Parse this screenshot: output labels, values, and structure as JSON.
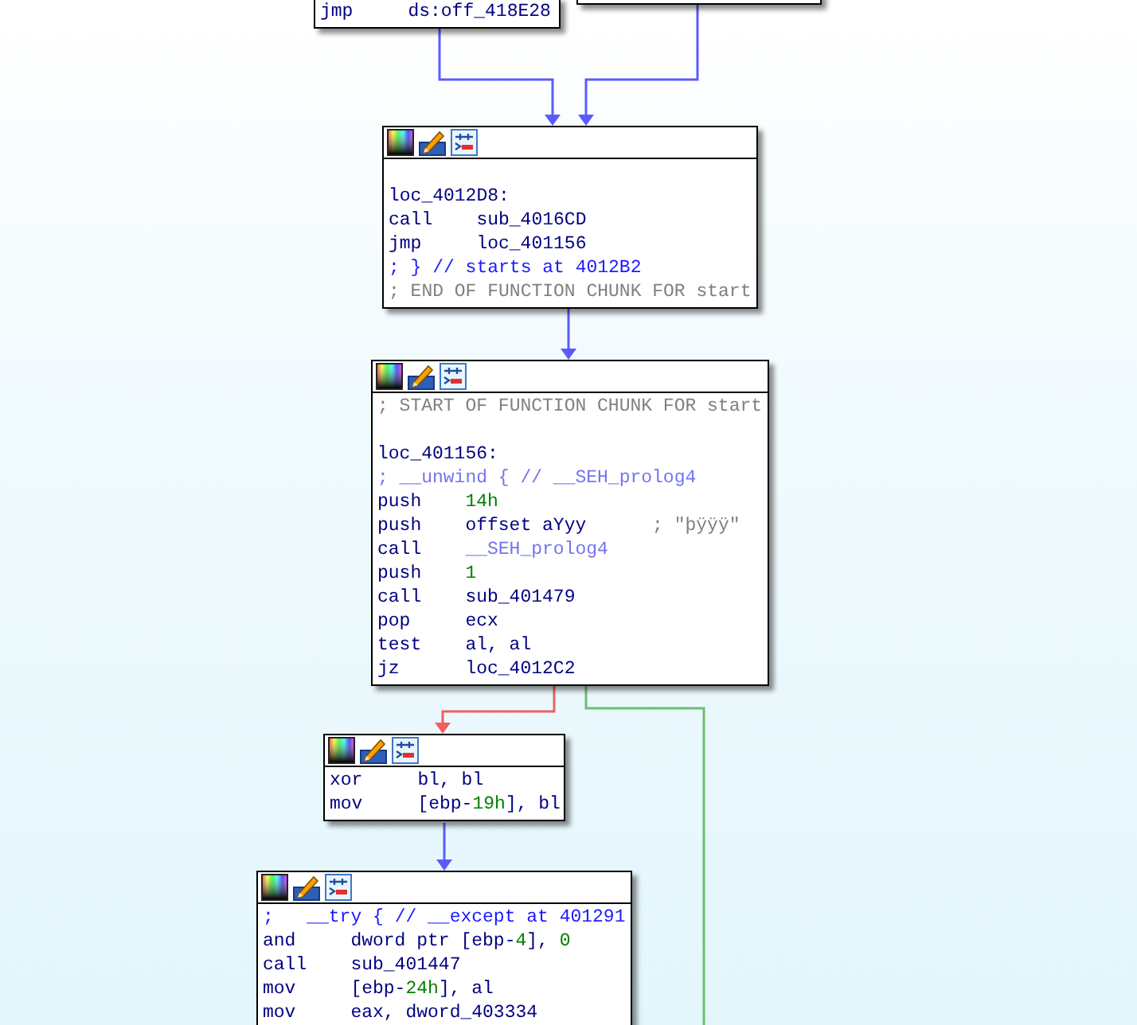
{
  "nodes": [
    {
      "toolbar": false,
      "lines": [
        {
          "kind": "instruction",
          "mnemonic": "jmp",
          "operands": [
            {
              "text": "ds:off_418E28",
              "kind": "plain"
            }
          ]
        }
      ]
    },
    {
      "toolbar": false
    },
    {
      "toolbar": true,
      "lines": [
        {
          "kind": "label",
          "text": "loc_4012D8:",
          "space_before": true
        },
        {
          "kind": "instruction",
          "mnemonic": "call",
          "operands": [
            {
              "text": "sub_4016CD",
              "kind": "plain"
            }
          ]
        },
        {
          "kind": "instruction",
          "mnemonic": "jmp",
          "operands": [
            {
              "text": "loc_401156",
              "kind": "plain"
            }
          ]
        },
        {
          "kind": "comment",
          "text": "; } // starts at 4012B2"
        },
        {
          "kind": "annotation",
          "text": "; END OF FUNCTION CHUNK FOR start"
        }
      ]
    },
    {
      "toolbar": true,
      "lines": [
        {
          "kind": "annotation",
          "text": "; START OF FUNCTION CHUNK FOR start"
        },
        {
          "kind": "label",
          "text": "loc_401156:",
          "space_before": true
        },
        {
          "kind": "hint",
          "text": "; __unwind { // __SEH_prolog4"
        },
        {
          "kind": "instruction",
          "mnemonic": "push",
          "operands": [
            {
              "text": "14h",
              "kind": "number"
            }
          ]
        },
        {
          "kind": "instruction",
          "mnemonic": "push",
          "operands": [
            {
              "text": "offset aYyy",
              "kind": "plain"
            }
          ],
          "comment": "; \"þÿÿÿ\""
        },
        {
          "kind": "instruction",
          "mnemonic": "call",
          "operands": [
            {
              "text": "__SEH_prolog4",
              "kind": "faint"
            }
          ]
        },
        {
          "kind": "instruction",
          "mnemonic": "push",
          "operands": [
            {
              "text": "1",
              "kind": "number"
            }
          ]
        },
        {
          "kind": "instruction",
          "mnemonic": "call",
          "operands": [
            {
              "text": "sub_401479",
              "kind": "plain"
            }
          ]
        },
        {
          "kind": "instruction",
          "mnemonic": "pop",
          "operands": [
            {
              "text": "ecx",
              "kind": "plain"
            }
          ]
        },
        {
          "kind": "instruction",
          "mnemonic": "test",
          "operands": [
            {
              "text": "al, al",
              "kind": "plain"
            }
          ]
        },
        {
          "kind": "instruction",
          "mnemonic": "jz",
          "operands": [
            {
              "text": "loc_4012C2",
              "kind": "plain"
            }
          ]
        }
      ]
    },
    {
      "toolbar": true,
      "lines": [
        {
          "kind": "instruction",
          "mnemonic": "xor",
          "operands": [
            {
              "text": "bl, bl",
              "kind": "plain"
            }
          ]
        },
        {
          "kind": "instruction",
          "mnemonic": "mov",
          "operands": [
            {
              "text": "[ebp-",
              "kind": "plain"
            },
            {
              "text": "19h",
              "kind": "number"
            },
            {
              "text": "], bl",
              "kind": "plain"
            }
          ]
        }
      ]
    },
    {
      "toolbar": true,
      "lines": [
        {
          "kind": "comment",
          "text": ";   __try { // __except at 401291"
        },
        {
          "kind": "instruction",
          "mnemonic": "and",
          "operands": [
            {
              "text": "dword ptr [ebp-",
              "kind": "plain"
            },
            {
              "text": "4",
              "kind": "number"
            },
            {
              "text": "], ",
              "kind": "plain"
            },
            {
              "text": "0",
              "kind": "number"
            }
          ]
        },
        {
          "kind": "instruction",
          "mnemonic": "call",
          "operands": [
            {
              "text": "sub_401447",
              "kind": "plain"
            }
          ]
        },
        {
          "kind": "instruction",
          "mnemonic": "mov",
          "operands": [
            {
              "text": "[ebp-",
              "kind": "plain"
            },
            {
              "text": "24h",
              "kind": "number"
            },
            {
              "text": "], al",
              "kind": "plain"
            }
          ]
        },
        {
          "kind": "instruction",
          "mnemonic": "mov",
          "operands": [
            {
              "text": "eax, dword_403334",
              "kind": "plain"
            }
          ]
        }
      ]
    }
  ],
  "edges": [
    {
      "color": "#5a5aff"
    },
    {
      "color": "#5a5aff"
    },
    {
      "color": "#5a5aff"
    },
    {
      "color": "#f06060"
    },
    {
      "color": "#6cbf6c"
    },
    {
      "color": "#5a5aff"
    }
  ]
}
